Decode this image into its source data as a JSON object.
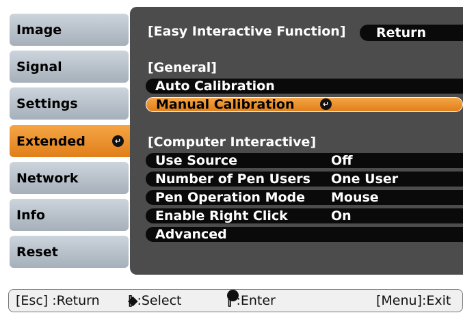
{
  "sidebar": {
    "items": [
      {
        "label": "Image"
      },
      {
        "label": "Signal"
      },
      {
        "label": "Settings"
      },
      {
        "label": "Extended",
        "active": true
      },
      {
        "label": "Network"
      },
      {
        "label": "Info"
      },
      {
        "label": "Reset"
      }
    ]
  },
  "panel": {
    "heading": "[Easy Interactive Function]",
    "return_label": "Return",
    "general_heading": "[General]",
    "general_items": [
      {
        "label": "Auto Calibration"
      },
      {
        "label": "Manual Calibration",
        "selected": true
      }
    ],
    "computer_heading": "[Computer Interactive]",
    "computer_items": [
      {
        "label": "Use Source",
        "value": "Off"
      },
      {
        "label": "Number of Pen Users",
        "value": "One User"
      },
      {
        "label": "Pen Operation Mode",
        "value": "Mouse"
      },
      {
        "label": "Enable Right Click",
        "value": "On"
      },
      {
        "label": "Advanced",
        "value": ""
      }
    ]
  },
  "footer": {
    "esc": "[Esc] :Return",
    "select_open": "[",
    "select_close": "] :Select",
    "enter_open": "[",
    "enter_close": "] :Enter",
    "menu": "[Menu]:Exit"
  },
  "icons": {
    "enter": "enter-icon",
    "updown": "updown-arrow-icon"
  },
  "colors": {
    "accent": "#ee9030",
    "panel_bg": "#4c4c4c",
    "nav_bg": "#b4bec8",
    "row_bg": "#0a0a0a"
  }
}
